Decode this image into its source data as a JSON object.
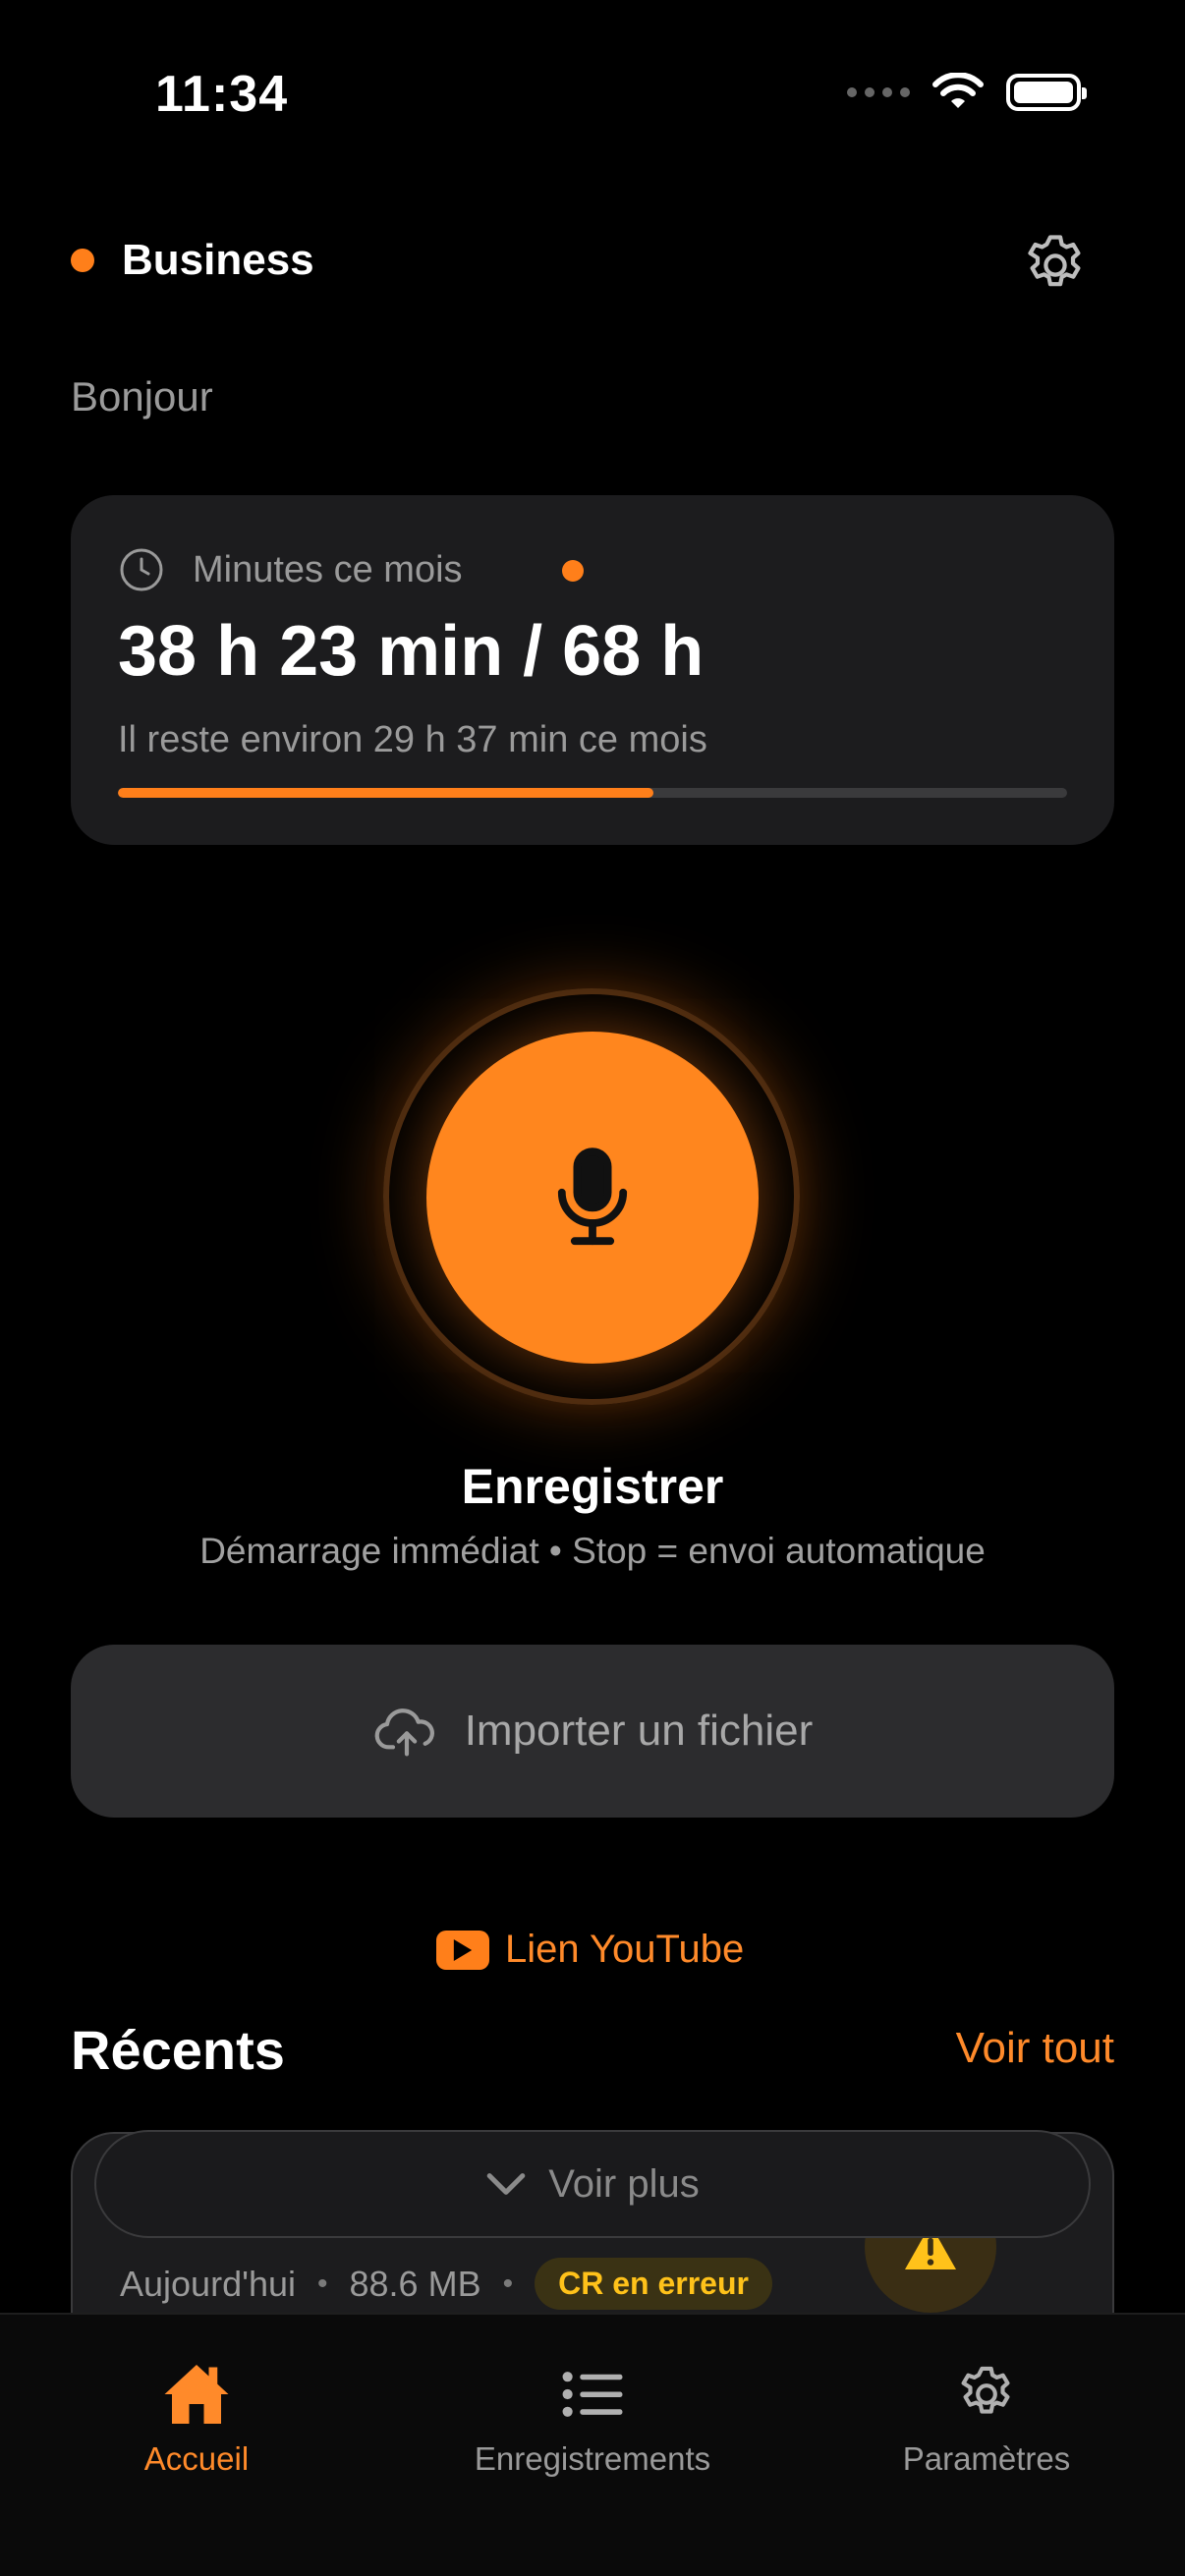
{
  "status_bar": {
    "time": "11:34"
  },
  "header": {
    "workspace_name": "Business",
    "greeting": "Bonjour"
  },
  "usage": {
    "label": "Minutes ce mois",
    "value": "38 h 23 min / 68 h",
    "remaining": "Il reste environ 29 h 37 min ce mois",
    "progress_fraction": 0.564
  },
  "record": {
    "title": "Enregistrer",
    "subtitle": "Démarrage immédiat • Stop = envoi automatique"
  },
  "import": {
    "label": "Importer un fichier"
  },
  "youtube": {
    "label": "Lien YouTube"
  },
  "recents": {
    "title": "Récents",
    "see_all": "Voir tout",
    "see_more": "Voir plus",
    "item": {
      "date": "Aujourd'hui",
      "size": "88.6 MB",
      "status_badge": "CR en erreur"
    }
  },
  "tabbar": {
    "tabs": [
      {
        "label": "Accueil",
        "icon": "home-icon",
        "active": true
      },
      {
        "label": "Enregistrements",
        "icon": "list-icon",
        "active": false
      },
      {
        "label": "Paramètres",
        "icon": "gear-icon",
        "active": false
      }
    ]
  },
  "colors": {
    "accent": "#FF7F1A",
    "warning": "#FFC21A",
    "card": "#1c1c1e"
  }
}
